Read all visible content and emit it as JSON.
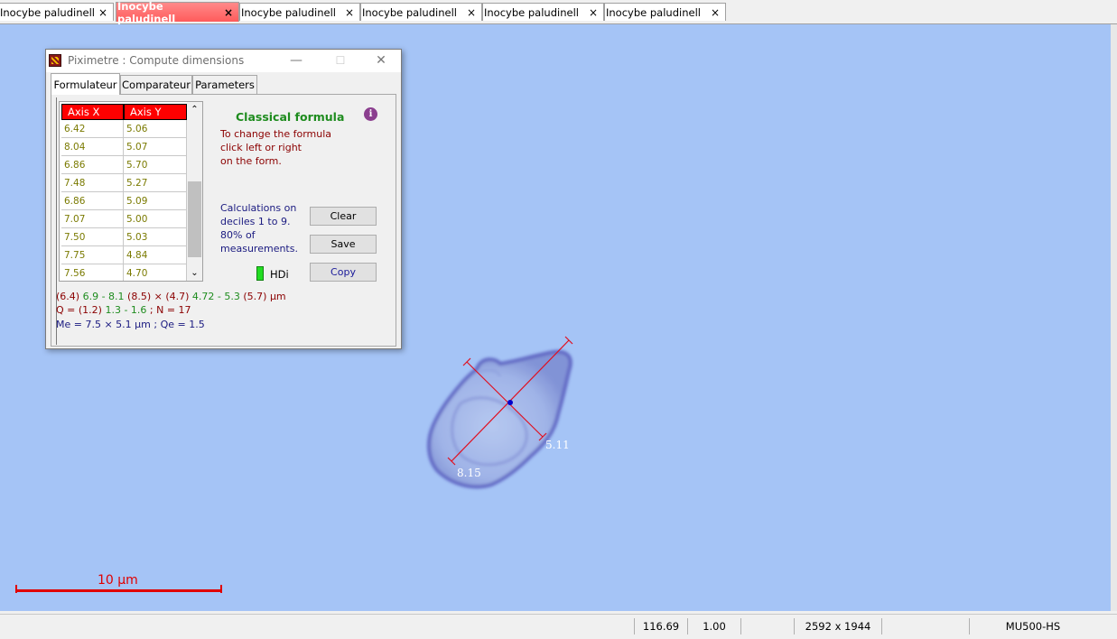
{
  "tabs": [
    {
      "label": "Inocybe paludinell",
      "close": "×",
      "active": false
    },
    {
      "label": "Inocybe paludinell",
      "close": "×",
      "active": true
    },
    {
      "label": "Inocybe paludinell",
      "close": "×",
      "active": false
    },
    {
      "label": "Inocybe paludinell",
      "close": "×",
      "active": false
    },
    {
      "label": "Inocybe paludinell",
      "close": "×",
      "active": false
    },
    {
      "label": "Inocybe paludinell",
      "close": "×",
      "active": false
    }
  ],
  "viewer": {
    "background_color": "#a5c4f6",
    "measure_long": "8.15",
    "measure_short": "5.11",
    "scale_bar_label": "10 μm",
    "measure_color": "#e01020"
  },
  "status": {
    "value1": "116.69",
    "value2": "1.00",
    "value3": "",
    "image_size": "2592 x 1944",
    "value5": "",
    "camera": "MU500-HS"
  },
  "dialog": {
    "title": "Piximetre : Compute dimensions",
    "min_icon": "—",
    "max_icon": "☐",
    "close_icon": "✕",
    "tabs": [
      "Formulateur",
      "Comparateur",
      "Parameters"
    ],
    "active_tab": "Formulateur",
    "grid": {
      "headers": [
        "Axis X",
        "Axis Y"
      ],
      "rows": [
        [
          "6.42",
          "5.06"
        ],
        [
          "8.04",
          "5.07"
        ],
        [
          "6.86",
          "5.70"
        ],
        [
          "7.48",
          "5.27"
        ],
        [
          "6.86",
          "5.09"
        ],
        [
          "7.07",
          "5.00"
        ],
        [
          "7.50",
          "5.03"
        ],
        [
          "7.75",
          "4.84"
        ],
        [
          "7.56",
          "4.70"
        ]
      ],
      "scroll_up": "⌃",
      "scroll_down": "⌄"
    },
    "formula_title": "Classical formula",
    "info_icon_glyph": "i",
    "formula_help": [
      "To change the formula",
      "click left or right",
      "on the form."
    ],
    "calc_note": [
      "Calculations on",
      "deciles 1 to 9.",
      "80% of",
      "measurements."
    ],
    "buttons": {
      "clear": "Clear",
      "save": "Save",
      "copy": "Copy"
    },
    "hdi_label": "HDi",
    "result_line1": {
      "a": "(6.4)",
      "b": "6.9 - 8.1",
      "c": "(8.5)",
      "d": "×",
      "e": "(4.7)",
      "f": "4.72 - 5.3",
      "g": "(5.7)",
      "h": "μm"
    },
    "result_line2": {
      "a": "Q =",
      "b": "(1.2)",
      "c": "1.3 - 1.6",
      "d": "; N = 17"
    },
    "result_line3": "Me = 7.5 × 5.1 μm ; Qe = 1.5"
  }
}
